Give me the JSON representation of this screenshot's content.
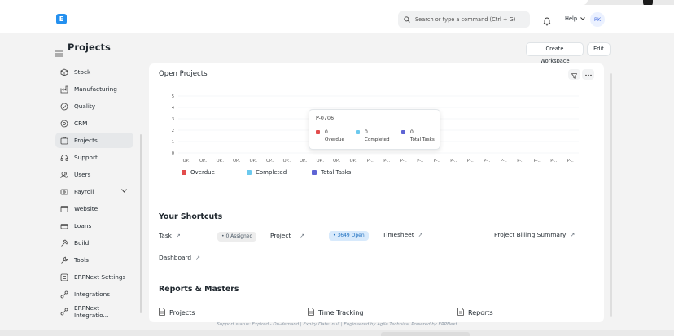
{
  "navbar": {
    "logo_letter": "E",
    "search_placeholder": "Search or type a command (Ctrl + G)",
    "help_label": "Help",
    "avatar_initials": "PK"
  },
  "header": {
    "title": "Projects",
    "create_workspace_label": "Create Workspace",
    "edit_label": "Edit"
  },
  "sidebar": {
    "items": [
      {
        "label": "Stock",
        "icon": "stock-icon"
      },
      {
        "label": "Manufacturing",
        "icon": "manufacturing-icon"
      },
      {
        "label": "Quality",
        "icon": "quality-icon"
      },
      {
        "label": "CRM",
        "icon": "crm-icon"
      },
      {
        "label": "Projects",
        "icon": "projects-icon",
        "active": true
      },
      {
        "label": "Support",
        "icon": "support-icon"
      },
      {
        "label": "Users",
        "icon": "users-icon"
      },
      {
        "label": "Payroll",
        "icon": "payroll-icon",
        "expandable": true
      },
      {
        "label": "Website",
        "icon": "website-icon"
      },
      {
        "label": "Loans",
        "icon": "loans-icon"
      },
      {
        "label": "Build",
        "icon": "build-icon"
      },
      {
        "label": "Tools",
        "icon": "tools-icon"
      },
      {
        "label": "ERPNext Settings",
        "icon": "settings-icon"
      },
      {
        "label": "Integrations",
        "icon": "integrations-icon"
      },
      {
        "label": "ERPNext Integratio...",
        "icon": "integrations-icon"
      }
    ]
  },
  "open_projects": {
    "title": "Open Projects",
    "tooltip": {
      "title": "P-0706",
      "items": [
        {
          "label": "Overdue",
          "value": "0"
        },
        {
          "label": "Completed",
          "value": "0"
        },
        {
          "label": "Total Tasks",
          "value": "0"
        }
      ]
    }
  },
  "colors": {
    "overdue": "#e24c4c",
    "completed": "#6cc9ee",
    "total_tasks": "#5e64d4",
    "accent": "#2490ef"
  },
  "chart_data": {
    "type": "bar",
    "categories": [
      "OP..",
      "OP..",
      "OP..",
      "OP..",
      "OP..",
      "OP..",
      "OP..",
      "OP..",
      "OP..",
      "OP..",
      "OP..",
      "P-..",
      "P-..",
      "P-..",
      "P-..",
      "P-..",
      "P-..",
      "P-..",
      "P-..",
      "P-..",
      "P-..",
      "P-..",
      "P-..",
      "P-.."
    ],
    "series": [
      {
        "name": "Overdue",
        "values": [
          0,
          0,
          0,
          0,
          0,
          0,
          0,
          0,
          0,
          0,
          0,
          0,
          0,
          0,
          0,
          0,
          0,
          0,
          0,
          0,
          0,
          0,
          0,
          0
        ]
      },
      {
        "name": "Completed",
        "values": [
          0,
          0,
          0,
          0,
          0,
          0,
          0,
          0,
          0,
          0,
          0,
          0,
          0,
          0,
          0,
          0,
          0,
          0,
          0,
          0,
          0,
          0,
          0,
          0
        ]
      },
      {
        "name": "Total Tasks",
        "values": [
          0,
          0,
          0,
          0,
          0,
          0,
          0,
          0,
          0,
          0,
          0,
          0,
          0,
          0,
          0,
          0,
          0,
          0,
          0,
          0,
          0,
          0,
          0,
          0
        ]
      }
    ],
    "y_ticks": [
      "0",
      "1",
      "2",
      "3",
      "4",
      "5"
    ],
    "ylim": [
      0,
      5
    ],
    "grid": true,
    "legend": "bottom-left"
  },
  "shortcuts": {
    "title": "Your Shortcuts",
    "items": [
      {
        "label": "Task",
        "badge": "• 0 Assigned"
      },
      {
        "label": "Project",
        "badge": "• 3649 Open"
      },
      {
        "label": "Timesheet"
      },
      {
        "label": "Project Billing Summary"
      },
      {
        "label": "Dashboard"
      }
    ],
    "arrow": "↗"
  },
  "reports": {
    "title": "Reports & Masters",
    "items": [
      {
        "label": "Projects"
      },
      {
        "label": "Time Tracking"
      },
      {
        "label": "Reports"
      }
    ]
  },
  "footer": {
    "status": "Support status: Expired - On-demand | Expiry Date: null | Engineered by Agile Technica, Powered by ERPNext"
  }
}
